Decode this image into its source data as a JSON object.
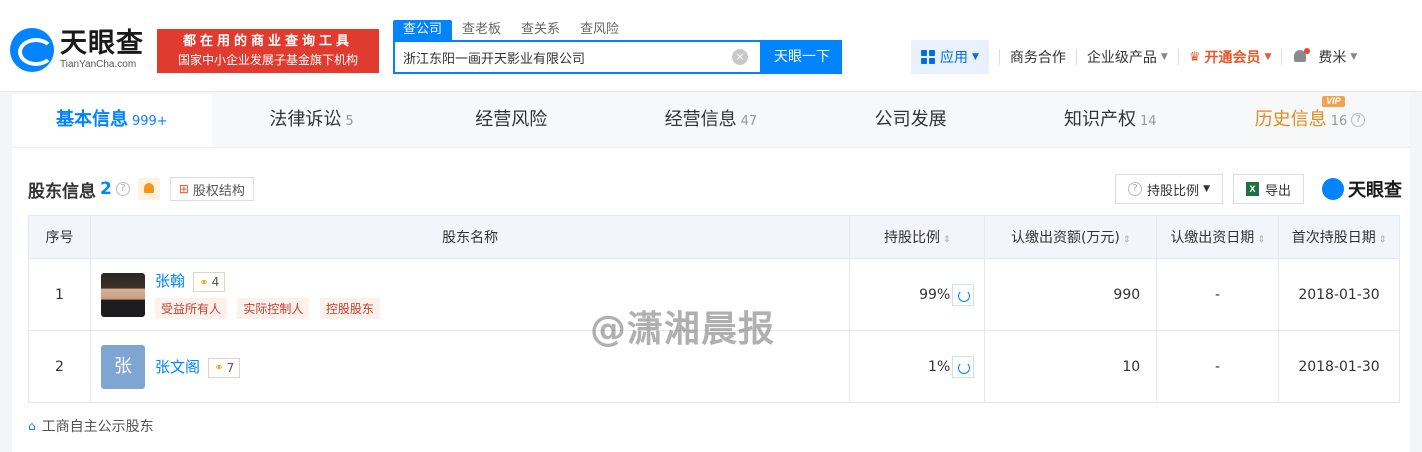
{
  "header": {
    "logo_cn": "天眼查",
    "logo_en": "TianYanCha.com",
    "slogan_line1": "都在用的商业查询工具",
    "slogan_line2": "国家中小企业发展子基金旗下机构",
    "search_tabs": [
      "查公司",
      "查老板",
      "查关系",
      "查风险"
    ],
    "search_value": "浙江东阳一画开天影业有限公司",
    "clear_icon": "×",
    "search_button": "天眼一下",
    "nav": {
      "apps": "应用",
      "business": "商务合作",
      "enterprise": "企业级产品",
      "vip": "开通会员",
      "user": "费米"
    }
  },
  "tabs": [
    {
      "label": "基本信息",
      "count": "999+"
    },
    {
      "label": "法律诉讼",
      "count": "5"
    },
    {
      "label": "经营风险",
      "count": ""
    },
    {
      "label": "经营信息",
      "count": "47"
    },
    {
      "label": "公司发展",
      "count": ""
    },
    {
      "label": "知识产权",
      "count": "14"
    },
    {
      "label": "历史信息",
      "count": "16",
      "badge": "VIP"
    }
  ],
  "section": {
    "title": "股东信息",
    "count": "2",
    "structure_button": "股权结构",
    "ratio_button": "持股比例",
    "export_button": "导出",
    "brand": "天眼查"
  },
  "table": {
    "headers": [
      "序号",
      "股东名称",
      "持股比例",
      "认缴出资额(万元)",
      "认缴出资日期",
      "首次持股日期"
    ],
    "rows": [
      {
        "idx": "1",
        "name": "张翰",
        "relations": "4",
        "tags": [
          "受益所有人",
          "实际控制人",
          "控股股东"
        ],
        "pct": "99%",
        "amount": "990",
        "date": "-",
        "first": "2018-01-30"
      },
      {
        "idx": "2",
        "name": "张文阁",
        "avatar": "张",
        "relations": "7",
        "tags": [],
        "pct": "1%",
        "amount": "10",
        "date": "-",
        "first": "2018-01-30"
      }
    ]
  },
  "footer_link": "工商自主公示股东",
  "watermark": "@潇湘晨报",
  "colors": {
    "brand": "#0084ff",
    "slogan": "#e03b2e",
    "vip": "#e8572a",
    "history": "#e38b1f"
  }
}
